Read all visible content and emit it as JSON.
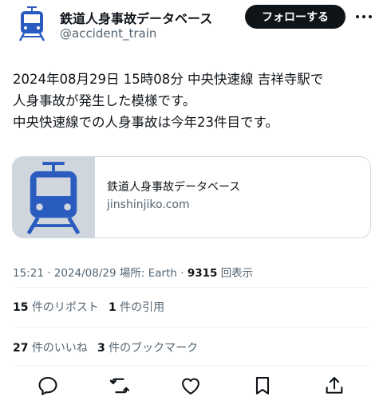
{
  "profile": {
    "name": "鉄道人身事故データベース",
    "handle": "@accident_train",
    "follow_label": "フォローする"
  },
  "tweet": {
    "lines": [
      "2024年08月29日 15時08分 中央快速線 吉祥寺駅で",
      "人身事故が発生した模様です。",
      "中央快速線での人身事故は今年23件目です。"
    ]
  },
  "card": {
    "title": "鉄道人身事故データベース",
    "domain": "jinshinjiko.com"
  },
  "meta": {
    "time": "15:21",
    "date": "2024/08/29",
    "location_label": "場所: Earth",
    "views_count": "9315",
    "views_label": "回表示",
    "sep": " · "
  },
  "stats": {
    "reposts_count": "15",
    "reposts_label": "件のリポスト",
    "quotes_count": "1",
    "quotes_label": "件の引用",
    "likes_count": "27",
    "likes_label": "件のいいね",
    "bookmarks_count": "3",
    "bookmarks_label": "件のブックマーク"
  },
  "colors": {
    "brand_blue": "#2a5cbf",
    "text_primary": "#0f1419",
    "text_secondary": "#536471",
    "border": "#cfd9de"
  },
  "icons": [
    "train-logo-icon",
    "more-icon",
    "reply-icon",
    "repost-icon",
    "like-icon",
    "bookmark-icon",
    "share-icon"
  ]
}
